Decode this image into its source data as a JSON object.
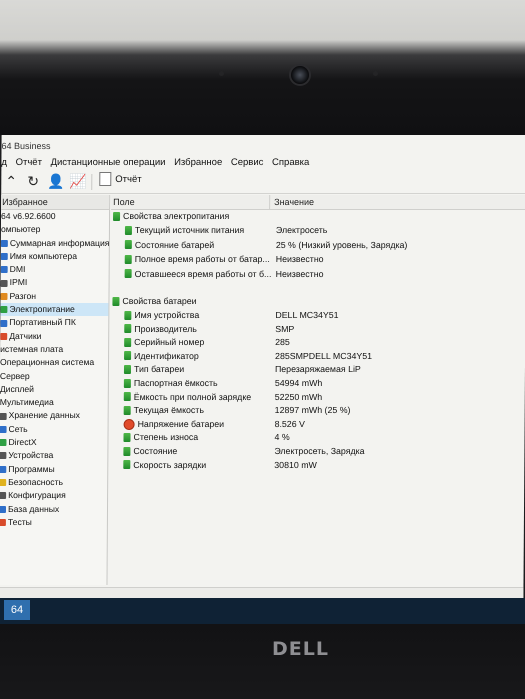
{
  "app": {
    "title": "64 Business"
  },
  "menu": [
    "д",
    "Отчёт",
    "Дистанционные операции",
    "Избранное",
    "Сервис",
    "Справка"
  ],
  "toolbar": {
    "report_label": "Отчёт"
  },
  "left_panel": {
    "header": "Избранное",
    "items": [
      {
        "label": "64 v6.92.6600",
        "color": ""
      },
      {
        "label": "омпьютер",
        "color": ""
      },
      {
        "label": "Суммарная информация",
        "color": "#2f6fc9"
      },
      {
        "label": "Имя компьютера",
        "color": "#2f6fc9"
      },
      {
        "label": "DMI",
        "color": "#2f6fc9"
      },
      {
        "label": "IPMI",
        "color": "#555555"
      },
      {
        "label": "Разгон",
        "color": "#e08a1e"
      },
      {
        "label": "Электропитание",
        "color": "#2ea043",
        "selected": true
      },
      {
        "label": "Портативный ПК",
        "color": "#2f6fc9"
      },
      {
        "label": "Датчики",
        "color": "#d84b2a"
      },
      {
        "label": "истемная плата",
        "color": ""
      },
      {
        "label": "Операционная система",
        "color": ""
      },
      {
        "label": "Сервер",
        "color": ""
      },
      {
        "label": "Дисплей",
        "color": ""
      },
      {
        "label": "Мультимедиа",
        "color": ""
      },
      {
        "label": "Хранение данных",
        "color": "#555555"
      },
      {
        "label": "Сеть",
        "color": "#2f6fc9"
      },
      {
        "label": "DirectX",
        "color": "#2ea043"
      },
      {
        "label": "Устройства",
        "color": "#555555"
      },
      {
        "label": "Программы",
        "color": "#2f6fc9"
      },
      {
        "label": "Безопасность",
        "color": "#e0b21e"
      },
      {
        "label": "Конфигурация",
        "color": "#555555"
      },
      {
        "label": "База данных",
        "color": "#2f6fc9"
      },
      {
        "label": "Тесты",
        "color": "#d84b2a"
      }
    ]
  },
  "columns": {
    "field": "Поле",
    "value": "Значение"
  },
  "power_section": {
    "title": "Свойства электропитания",
    "rows": [
      {
        "field": "Текущий источник питания",
        "value": "Электросеть"
      },
      {
        "field": "Состояние батарей",
        "value": "25 % (Низкий уровень, Зарядка)"
      },
      {
        "field": "Полное время работы от батар...",
        "value": "Неизвестно"
      },
      {
        "field": "Оставшееся время работы от б...",
        "value": "Неизвестно"
      }
    ]
  },
  "battery_section": {
    "title": "Свойства батареи",
    "rows": [
      {
        "field": "Имя устройства",
        "value": "DELL MC34Y51",
        "icon": "green"
      },
      {
        "field": "Производитель",
        "value": "SMP",
        "icon": "green"
      },
      {
        "field": "Серийный номер",
        "value": "285",
        "icon": "green"
      },
      {
        "field": "Идентификатор",
        "value": "285SMPDELL MC34Y51",
        "icon": "green"
      },
      {
        "field": "Тип батареи",
        "value": "Перезаряжаемая LiP",
        "icon": "green"
      },
      {
        "field": "Паспортная ёмкость",
        "value": "54994 mWh",
        "icon": "green"
      },
      {
        "field": "Ёмкость при полной зарядке",
        "value": "52250 mWh",
        "icon": "green"
      },
      {
        "field": "Текущая ёмкость",
        "value": "12897 mWh  (25 %)",
        "icon": "green"
      },
      {
        "field": "Напряжение батареи",
        "value": "8.526 V",
        "icon": "red"
      },
      {
        "field": "Степень износа",
        "value": "4 %",
        "icon": "green"
      },
      {
        "field": "Состояние",
        "value": "Электросеть, Зарядка",
        "icon": "green"
      },
      {
        "field": "Скорость зарядки",
        "value": "30810 mW",
        "icon": "green"
      }
    ]
  },
  "taskbar": {
    "button_label": "64"
  },
  "brand": {
    "logo": "DELL"
  }
}
